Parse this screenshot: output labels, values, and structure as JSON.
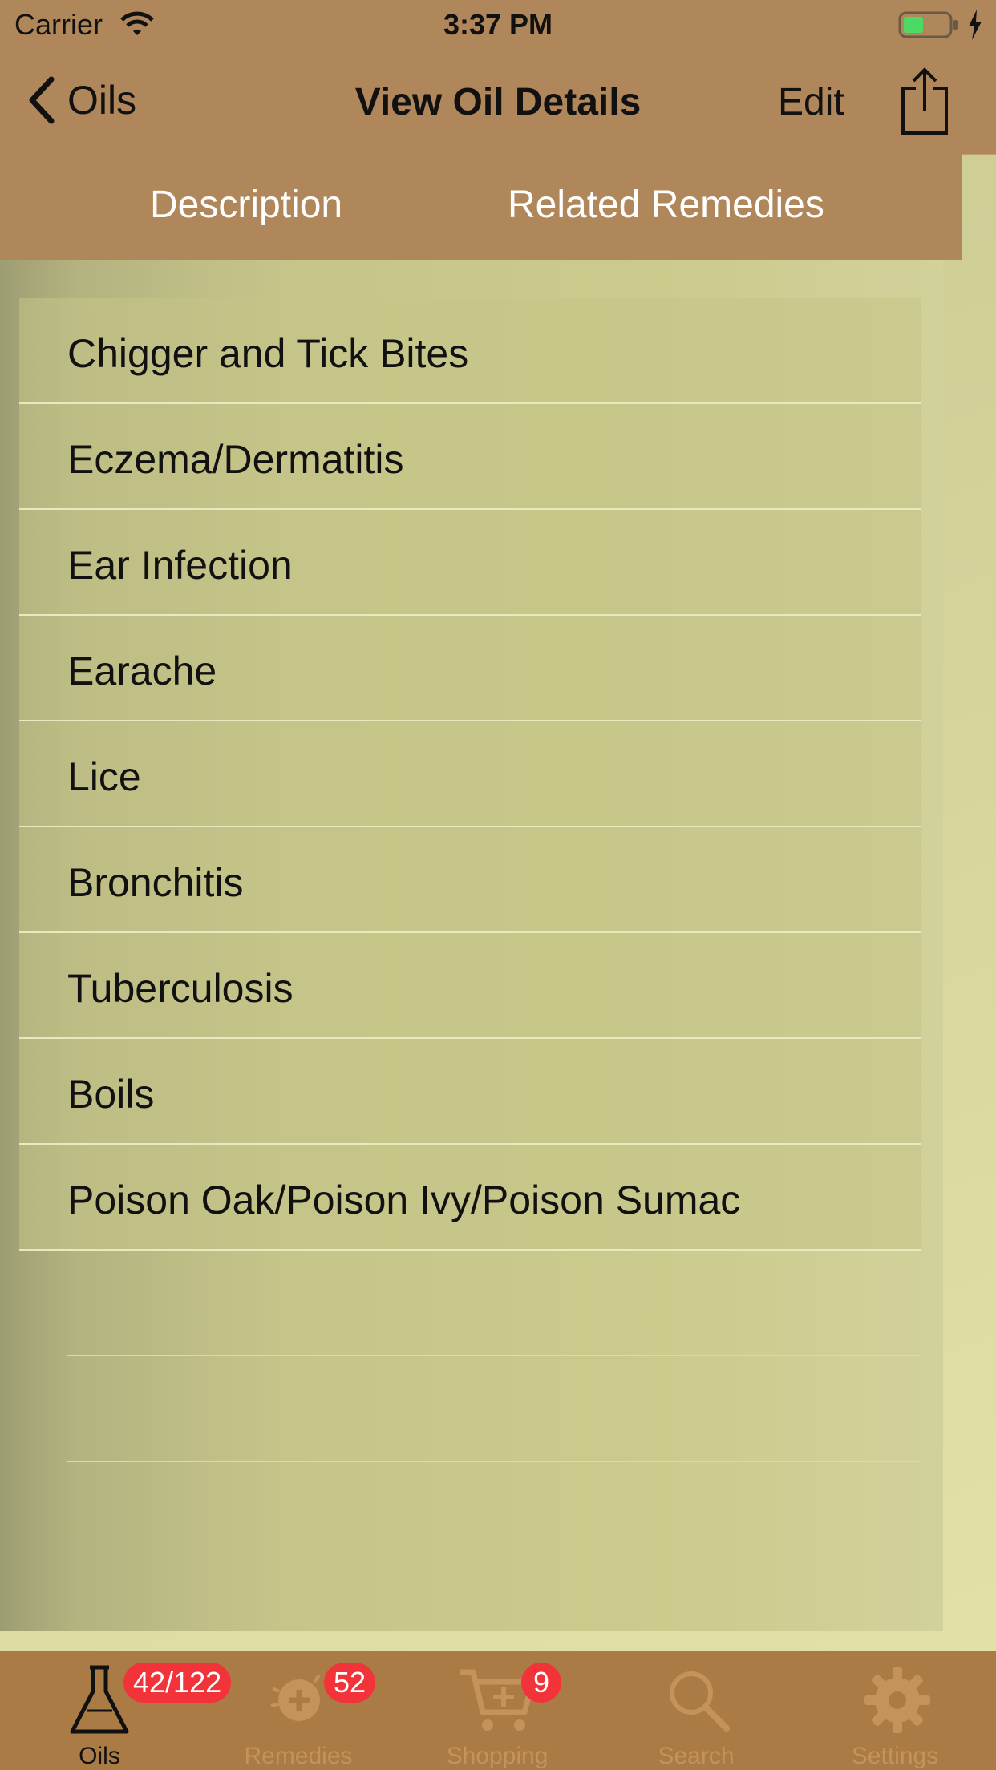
{
  "status_bar": {
    "carrier": "Carrier",
    "time": "3:37 PM"
  },
  "navbar": {
    "back_label": "Oils",
    "title": "View Oil Details",
    "edit_label": "Edit"
  },
  "segments": {
    "description": "Description",
    "related": "Related Remedies"
  },
  "remedies": [
    "Chigger and Tick Bites",
    "Eczema/Dermatitis",
    "Ear Infection",
    "Earache",
    "Lice",
    "Bronchitis",
    "Tuberculosis",
    "Boils",
    "Poison Oak/Poison Ivy/Poison Sumac"
  ],
  "tabbar": {
    "oils": {
      "label": "Oils",
      "badge": "42/122"
    },
    "remedies": {
      "label": "Remedies",
      "badge": "52"
    },
    "shopping": {
      "label": "Shopping",
      "badge": "9"
    },
    "search": {
      "label": "Search"
    },
    "settings": {
      "label": "Settings"
    }
  },
  "colors": {
    "bar": "#b0875a",
    "tabbar": "#aa7b45",
    "badge": "#f2343a",
    "battery": "#4cd964"
  }
}
